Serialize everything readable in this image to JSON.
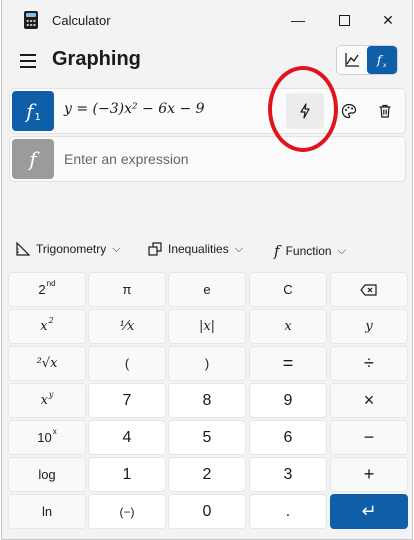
{
  "window": {
    "app_title": "Calculator",
    "minimize": "—",
    "close": "✕"
  },
  "header": {
    "page_title": "Graphing"
  },
  "expressions": [
    {
      "index": "1",
      "text": "y = (−3)x² − 6x − 9",
      "active": true
    },
    {
      "placeholder": "Enter an expression"
    }
  ],
  "categories": {
    "trig": "Trigonometry",
    "ineq": "Inequalities",
    "func": "Function",
    "func_symbol": "f"
  },
  "keys": {
    "r1": [
      "2",
      "π",
      "e",
      "C",
      "⌫"
    ],
    "r2": [
      "x²",
      "¹⁄x",
      "|x|",
      "x",
      "y"
    ],
    "r3": [
      "²√x",
      "(",
      ")",
      "=",
      "÷"
    ],
    "r4": [
      "xʸ",
      "7",
      "8",
      "9",
      "×"
    ],
    "r5": [
      "10ˣ",
      "4",
      "5",
      "6",
      "−"
    ],
    "r6": [
      "log",
      "1",
      "2",
      "3",
      "+"
    ],
    "r7": [
      "ln",
      "(−)",
      "0",
      ".",
      "↵"
    ],
    "second_sup": "nd",
    "tenx_base": "10",
    "tenx_sup": "x",
    "xy_base": "x",
    "xy_sup": "y",
    "x2_base": "x",
    "x2_sup": "2"
  },
  "colors": {
    "accent": "#0f5ea8",
    "annotation": "#e0141e"
  }
}
